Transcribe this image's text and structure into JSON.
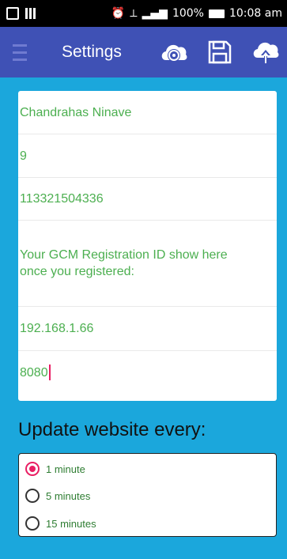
{
  "status_bar": {
    "battery_percent": "100%",
    "time": "10:08 am"
  },
  "toolbar": {
    "title": "Settings",
    "icons": [
      "menu-icon",
      "cloud-sync-icon",
      "save-icon",
      "cloud-upload-icon"
    ]
  },
  "fields": [
    {
      "value": "Chandrahas Ninave"
    },
    {
      "value": "9"
    },
    {
      "value": "113321504336"
    },
    {
      "value": "Your GCM Registration ID show here once you registered:"
    },
    {
      "value": "192.168.1.66"
    },
    {
      "value": "8080"
    }
  ],
  "update": {
    "title": "Update website every:",
    "options": [
      {
        "label": "1 minute",
        "checked": true
      },
      {
        "label": "5 minutes",
        "checked": false
      },
      {
        "label": "15 minutes",
        "checked": false
      }
    ]
  },
  "colors": {
    "toolbar": "#3f51b5",
    "background": "#1ba7dc",
    "text_green": "#4caf50",
    "accent": "#e91e63"
  }
}
